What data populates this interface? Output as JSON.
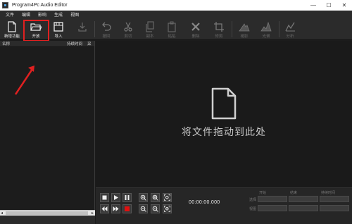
{
  "window": {
    "title": "Program4Pc Audio Editor",
    "controls": {
      "minimize": "—",
      "maximize": "☐",
      "close": "✕"
    }
  },
  "menu": [
    "文件",
    "编辑",
    "影响",
    "生成",
    "视图"
  ],
  "toolbar": {
    "new_recording": "新增功能",
    "open": "开放",
    "import": "导入",
    "save": "",
    "undo": "撤回",
    "cut": "剪切",
    "copy": "副本",
    "paste": "粘贴",
    "delete": "删除",
    "crop": "修剪",
    "fade_in": "褪影",
    "fade_out": "光谱",
    "analyze": "分析"
  },
  "file_list": {
    "columns": [
      "名称",
      "持续时间",
      "采"
    ]
  },
  "main": {
    "drop_hint": "将文件拖动到此处"
  },
  "transport": {
    "time": "00:00:00.000",
    "field_labels": [
      "开始",
      "结束",
      "持续时间",
      "选择",
      "视图"
    ],
    "record_color": "#e01010"
  },
  "annotations": {
    "color": "#e02020"
  }
}
